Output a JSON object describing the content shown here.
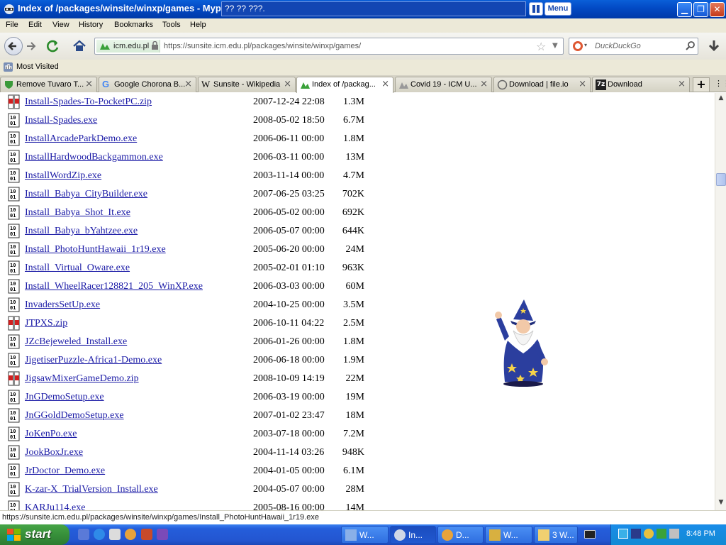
{
  "window": {
    "title": "Index of /packages/winsite/winxp/games - Mypc",
    "overlay_text": "?? ?? ???.",
    "menu_button": "Menu",
    "min_icon": "minimize-icon",
    "max_icon": "restore-icon",
    "close_icon": "close-icon"
  },
  "menubar": [
    "File",
    "Edit",
    "View",
    "History",
    "Bookmarks",
    "Tools",
    "Help"
  ],
  "navbar": {
    "site_identity": "icm.edu.pl",
    "url": "https://sunsite.icm.edu.pl/packages/winsite/winxp/games/",
    "search_placeholder": "DuckDuckGo"
  },
  "bookmarks": {
    "most_visited": "Most Visited"
  },
  "tabs": [
    {
      "label": "Remove Tuvaro T...",
      "active": false
    },
    {
      "label": "Google Chorona B...",
      "active": false
    },
    {
      "label": "Sunsite - Wikipedia",
      "active": false
    },
    {
      "label": "Index of /packag...",
      "active": true
    },
    {
      "label": "Covid 19 - ICM U...",
      "active": false
    },
    {
      "label": "Download | file.io",
      "active": false
    },
    {
      "label": "Download",
      "active": false
    }
  ],
  "listing": [
    {
      "name": "Install-Spades-To-PocketPC.zip",
      "date": "2007-12-24 22:08",
      "size": "1.3M",
      "type": "zip"
    },
    {
      "name": "Install-Spades.exe",
      "date": "2008-05-02 18:50",
      "size": "6.7M",
      "type": "exe"
    },
    {
      "name": "InstallArcadeParkDemo.exe",
      "date": "2006-06-11 00:00",
      "size": "1.8M",
      "type": "exe"
    },
    {
      "name": "InstallHardwoodBackgammon.exe",
      "date": "2006-03-11 00:00",
      "size": "13M",
      "type": "exe"
    },
    {
      "name": "InstallWordZip.exe",
      "date": "2003-11-14 00:00",
      "size": "4.7M",
      "type": "exe"
    },
    {
      "name": "Install_Babya_CityBuilder.exe",
      "date": "2007-06-25 03:25",
      "size": "702K",
      "type": "exe"
    },
    {
      "name": "Install_Babya_Shot_It.exe",
      "date": "2006-05-02 00:00",
      "size": "692K",
      "type": "exe"
    },
    {
      "name": "Install_Babya_bYahtzee.exe",
      "date": "2006-05-07 00:00",
      "size": "644K",
      "type": "exe"
    },
    {
      "name": "Install_PhotoHuntHawaii_1r19.exe",
      "date": "2005-06-20 00:00",
      "size": "24M",
      "type": "exe"
    },
    {
      "name": "Install_Virtual_Oware.exe",
      "date": "2005-02-01 01:10",
      "size": "963K",
      "type": "exe"
    },
    {
      "name": "Install_WheelRacer128821_205_WinXP.exe",
      "date": "2006-03-03 00:00",
      "size": "60M",
      "type": "exe"
    },
    {
      "name": "InvadersSetUp.exe",
      "date": "2004-10-25 00:00",
      "size": "3.5M",
      "type": "exe"
    },
    {
      "name": "JTPXS.zip",
      "date": "2006-10-11 04:22",
      "size": "2.5M",
      "type": "zip"
    },
    {
      "name": "JZcBejeweled_Install.exe",
      "date": "2006-01-26 00:00",
      "size": "1.8M",
      "type": "exe"
    },
    {
      "name": "JigetiserPuzzle-Africa1-Demo.exe",
      "date": "2006-06-18 00:00",
      "size": "1.9M",
      "type": "exe"
    },
    {
      "name": "JigsawMixerGameDemo.zip",
      "date": "2008-10-09 14:19",
      "size": "22M",
      "type": "zip"
    },
    {
      "name": "JnGDemoSetup.exe",
      "date": "2006-03-19 00:00",
      "size": "19M",
      "type": "exe"
    },
    {
      "name": "JnGGoldDemoSetup.exe",
      "date": "2007-01-02 23:47",
      "size": "18M",
      "type": "exe"
    },
    {
      "name": "JoKenPo.exe",
      "date": "2003-07-18 00:00",
      "size": "7.2M",
      "type": "exe"
    },
    {
      "name": "JookBoxJr.exe",
      "date": "2004-11-14 03:26",
      "size": "948K",
      "type": "exe"
    },
    {
      "name": "JrDoctor_Demo.exe",
      "date": "2004-01-05 00:00",
      "size": "6.1M",
      "type": "exe"
    },
    {
      "name": "K-zar-X_TrialVersion_Install.exe",
      "date": "2004-05-07 00:00",
      "size": "28M",
      "type": "exe"
    },
    {
      "name": "KARJu114.exe",
      "date": "2005-08-16 00:00",
      "size": "14M",
      "type": "exe"
    }
  ],
  "status_url": "https://sunsite.icm.edu.pl/packages/winsite/winxp/games/Install_PhotoHuntHawaii_1r19.exe",
  "taskbar": {
    "start_label": "start",
    "tasks": [
      {
        "label": "W...",
        "active": false
      },
      {
        "label": "In...",
        "active": true
      },
      {
        "label": "D...",
        "active": false
      },
      {
        "label": "W...",
        "active": false
      },
      {
        "label": "3 W...",
        "active": false
      }
    ],
    "clock": "8:48 PM"
  },
  "colors": {
    "link": "#1a1aa6",
    "titlebar": "#0249c4",
    "taskbar": "#245edb",
    "start": "#37903a"
  }
}
